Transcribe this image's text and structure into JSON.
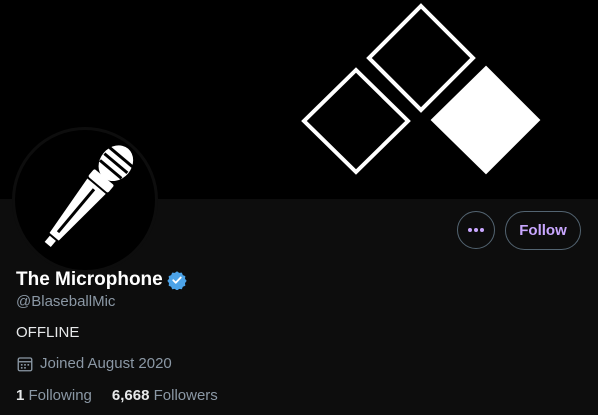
{
  "profile": {
    "display_name": "The Microphone",
    "handle": "@BlaseballMic",
    "bio": "OFFLINE",
    "joined": "Joined August 2020",
    "verified": true,
    "accent_color": "#c9a7ff",
    "verified_color": "#4ca3e8"
  },
  "actions": {
    "more_icon": "more-horizontal-icon",
    "follow_label": "Follow"
  },
  "stats": {
    "following_count": "1",
    "following_label": "Following",
    "followers_count": "6,668",
    "followers_label": "Followers"
  },
  "icons": {
    "avatar": "microphone-icon",
    "calendar": "calendar-icon",
    "verified": "verified-badge-icon",
    "banner": "diamond-shapes"
  }
}
